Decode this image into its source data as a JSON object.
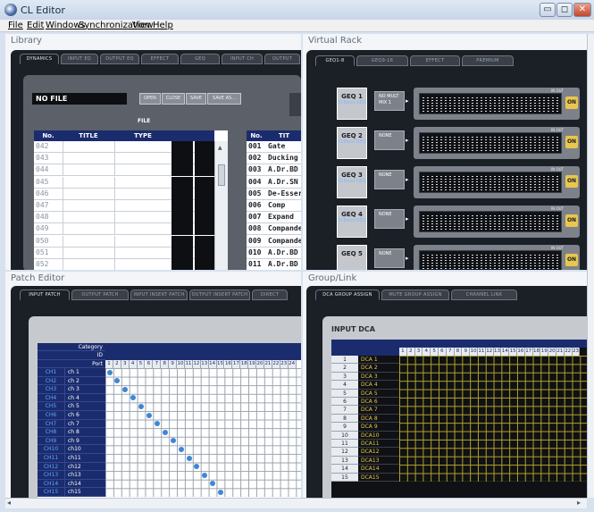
{
  "window": {
    "title": "CL Editor",
    "controls": [
      "▭",
      "◻",
      "✕"
    ]
  },
  "menu": [
    "File",
    "Edit",
    "Windows",
    "Synchronization",
    "View",
    "Help"
  ],
  "library": {
    "title": "Library",
    "tabs": [
      "DYNAMICS",
      "INPUT EQ",
      "OUTPUT EQ",
      "EFFECT",
      "GEQ",
      "INPUT CH",
      "OUTPUT"
    ],
    "file_name": "NO FILE",
    "buttons": [
      "OPEN",
      "CLOSE",
      "SAVE",
      "SAVE AS..."
    ],
    "file_label": "FILE",
    "file_table": {
      "headers": [
        "No.",
        "TITLE",
        "TYPE"
      ],
      "rows": [
        "042",
        "043",
        "044",
        "045",
        "046",
        "047",
        "048",
        "049",
        "050",
        "051",
        "052"
      ]
    },
    "preset_table": {
      "headers": [
        "No.",
        "TIT"
      ],
      "rows": [
        [
          "001",
          "Gate"
        ],
        [
          "002",
          "Ducking"
        ],
        [
          "003",
          "A.Dr.BD"
        ],
        [
          "004",
          "A.Dr.SN"
        ],
        [
          "005",
          "De-Esser"
        ],
        [
          "006",
          "Comp"
        ],
        [
          "007",
          "Expand"
        ],
        [
          "008",
          "Compander"
        ],
        [
          "009",
          "Compander"
        ],
        [
          "010",
          "A.Dr.BD"
        ],
        [
          "011",
          "A.Dr.BD"
        ]
      ]
    }
  },
  "rack": {
    "title": "Virtual Rack",
    "tabs": [
      "GEQ1-8",
      "GEQ9-16",
      "EFFECT",
      "PREMIUM"
    ],
    "units": [
      {
        "name": "GEQ 1",
        "type": "31Band GEQ",
        "patch": "NO MULT MIX 1"
      },
      {
        "name": "GEQ 2",
        "type": "31Band GEQ",
        "patch": "NONE"
      },
      {
        "name": "GEQ 3",
        "type": "31Band GEQ",
        "patch": "NONE"
      },
      {
        "name": "GEQ 4",
        "type": "31Band GEQ",
        "patch": "NONE"
      },
      {
        "name": "GEQ 5",
        "type": "",
        "patch": "NONE"
      }
    ],
    "in_out": "IN OUT",
    "on_label": "ON"
  },
  "patch": {
    "title": "Patch Editor",
    "tabs": [
      "INPUT PATCH",
      "OUTPUT PATCH",
      "INPUT INSERT PATCH",
      "OUTPUT INSERT PATCH",
      "DIRECT"
    ],
    "row_headers": [
      "Category",
      "ID",
      "Port"
    ],
    "ports": [
      "1",
      "2",
      "3",
      "4",
      "5",
      "6",
      "7",
      "8",
      "9",
      "10",
      "11",
      "12",
      "13",
      "14",
      "15",
      "16",
      "17",
      "18",
      "19",
      "20",
      "21",
      "22",
      "23",
      "24"
    ],
    "channels": [
      [
        "CH1",
        "ch 1"
      ],
      [
        "CH2",
        "ch 2"
      ],
      [
        "CH3",
        "ch 3"
      ],
      [
        "CH4",
        "ch 4"
      ],
      [
        "CH5",
        "ch 5"
      ],
      [
        "CH6",
        "ch 6"
      ],
      [
        "CH7",
        "ch 7"
      ],
      [
        "CH8",
        "ch 8"
      ],
      [
        "CH9",
        "ch 9"
      ],
      [
        "CH10",
        "ch10"
      ],
      [
        "CH11",
        "ch11"
      ],
      [
        "CH12",
        "ch12"
      ],
      [
        "CH13",
        "ch13"
      ],
      [
        "CH14",
        "ch14"
      ],
      [
        "CH15",
        "ch15"
      ]
    ]
  },
  "group": {
    "title": "Group/Link",
    "tabs": [
      "DCA GROUP ASSIGN",
      "MUTE GROUP ASSIGN",
      "CHANNEL LINK"
    ],
    "section": "INPUT DCA",
    "columns": [
      "1",
      "2",
      "3",
      "4",
      "5",
      "6",
      "7",
      "8",
      "9",
      "10",
      "11",
      "12",
      "13",
      "14",
      "15",
      "16",
      "17",
      "18",
      "19",
      "20",
      "21",
      "22",
      "23"
    ],
    "dcas": [
      [
        "1",
        "DCA 1"
      ],
      [
        "2",
        "DCA 2"
      ],
      [
        "3",
        "DCA 3"
      ],
      [
        "4",
        "DCA 4"
      ],
      [
        "5",
        "DCA 5"
      ],
      [
        "6",
        "DCA 6"
      ],
      [
        "7",
        "DCA 7"
      ],
      [
        "8",
        "DCA 8"
      ],
      [
        "9",
        "DCA 9"
      ],
      [
        "10",
        "DCA10"
      ],
      [
        "11",
        "DCA11"
      ],
      [
        "12",
        "DCA12"
      ],
      [
        "13",
        "DCA13"
      ],
      [
        "14",
        "DCA14"
      ],
      [
        "15",
        "DCA15"
      ]
    ]
  },
  "colors": {
    "accent": "#1b2c6e",
    "dark": "#1b1f26",
    "dca_grid": "#b4a22a",
    "patch_dot": "#3f86d8",
    "on_button": "#e9c64d"
  }
}
